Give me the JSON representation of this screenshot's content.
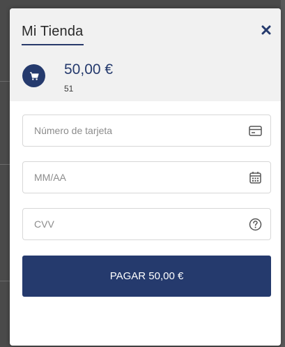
{
  "store": {
    "name": "Mi Tienda",
    "close_icon": "close-icon"
  },
  "summary": {
    "cart_icon": "shopping-cart-icon",
    "amount": "50,00 €",
    "order_number": "51"
  },
  "form": {
    "card_number": {
      "placeholder": "Número de tarjeta",
      "value": "",
      "icon": "credit-card-icon"
    },
    "expiry": {
      "placeholder": "MM/AA",
      "value": "",
      "icon": "calendar-icon"
    },
    "cvv": {
      "placeholder": "CVV",
      "value": "",
      "icon": "help-circle-icon"
    }
  },
  "pay_button": {
    "label": "PAGAR 50,00 €"
  },
  "colors": {
    "brand": "#253a6d",
    "header_bg": "#f1f1f1",
    "backdrop": "#4a4a4a"
  }
}
